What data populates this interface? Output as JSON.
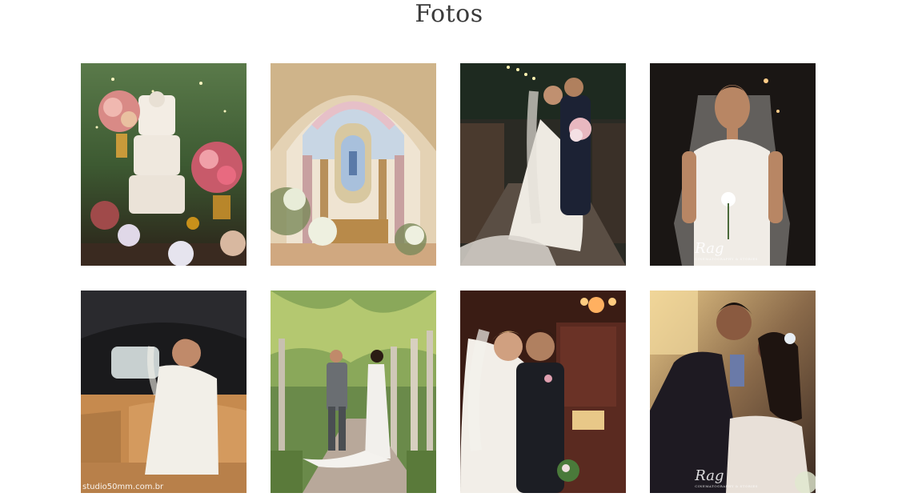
{
  "title": "Fotos",
  "photos": [
    {
      "name": "photo-wedding-cake-table",
      "alt": ""
    },
    {
      "name": "photo-church-altar",
      "alt": ""
    },
    {
      "name": "photo-couple-kiss-bridge",
      "alt": ""
    },
    {
      "name": "photo-bride-holding-rose",
      "alt": ""
    },
    {
      "name": "photo-bride-in-car",
      "alt": ""
    },
    {
      "name": "photo-couple-walking-palms",
      "alt": ""
    },
    {
      "name": "photo-couple-church-interior",
      "alt": ""
    },
    {
      "name": "photo-couple-kiss-sunset",
      "alt": ""
    }
  ],
  "watermarks": {
    "rag_logo": "Rag",
    "rag_sub": "CINEMATOGRAPHY & STORIES",
    "studio": "studio50mm.com.br"
  }
}
